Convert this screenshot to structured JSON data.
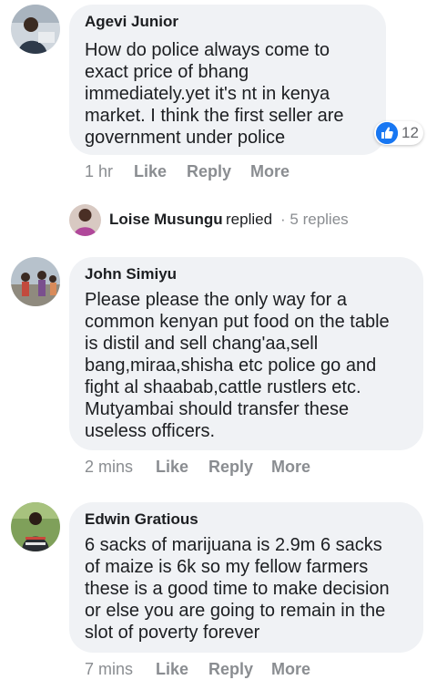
{
  "comments": [
    {
      "author": "Agevi Junior",
      "text": "How do police always come to exact price of bhang immediately.yet it's nt in kenya market. I think the first seller are government under police",
      "lines": [
        "How do police always come to",
        "exact price of bhang",
        "immediately.yet it's nt in kenya",
        "market. I think the first seller are",
        "government under police"
      ],
      "reaction_count": "12",
      "time": "1 hr",
      "like_label": "Like",
      "reply_label": "Reply",
      "more_label": "More"
    },
    {
      "author": "John Simiyu",
      "lines": [
        "Please please the only way for a",
        "common kenyan put food on the table",
        "is distil and sell chang'aa,sell",
        "bang,miraa,shisha etc police go and",
        "fight al shaabab,cattle rustlers etc.",
        "Mutyambai should transfer these",
        "useless officers."
      ],
      "time": "2 mins",
      "like_label": "Like",
      "reply_label": "Reply",
      "more_label": "More"
    },
    {
      "author": "Edwin Gratious",
      "lines": [
        "6 sacks of marijuana is 2.9m 6 sacks",
        "of maize is 6k so my fellow farmers",
        "these is a good time to make decision",
        "or else you are going to remain in the",
        "slot of poverty forever"
      ],
      "time": "7 mins",
      "like_label": "Like",
      "reply_label": "Reply",
      "more_label": "More"
    }
  ],
  "replies_summary": {
    "name": "Loise Musungu",
    "verb": "replied",
    "separator": "·",
    "count_text": "5 replies"
  },
  "colors": {
    "bubble": "#f0f2f5",
    "meta": "#8a8d91",
    "text": "#1c1e21",
    "like_blue": "#1877f2"
  },
  "icons": {
    "reaction": "like-thumb-icon"
  }
}
